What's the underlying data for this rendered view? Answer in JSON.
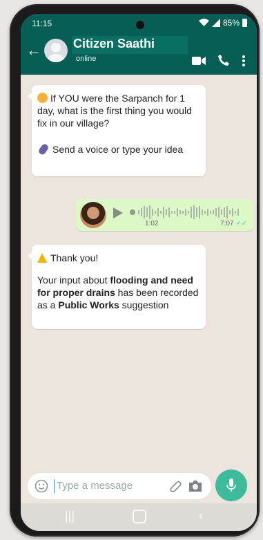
{
  "status": {
    "time": "11:15",
    "battery": "85%"
  },
  "header": {
    "title": "Citizen Saathi",
    "status": "online"
  },
  "messages": {
    "m1": {
      "line1": "If YOU were the Sarpanch for 1 day, what is the first thing you would fix in our village?",
      "line2": "Send a  voice or type your idea"
    },
    "voice": {
      "duration": "1:02",
      "time": "7:07"
    },
    "m3": {
      "thanks": "Thank you!",
      "p1": "Your input about ",
      "bold1": "flooding and need for proper drains",
      "p2": " has been recorded as a ",
      "bold2": "Public Works",
      "p3": " suggestion"
    }
  },
  "composer": {
    "placeholder": "Type a message"
  },
  "colors": {
    "header": "#075e54",
    "outgoing": "#dcf8c6",
    "mic": "#3dbb9a"
  }
}
